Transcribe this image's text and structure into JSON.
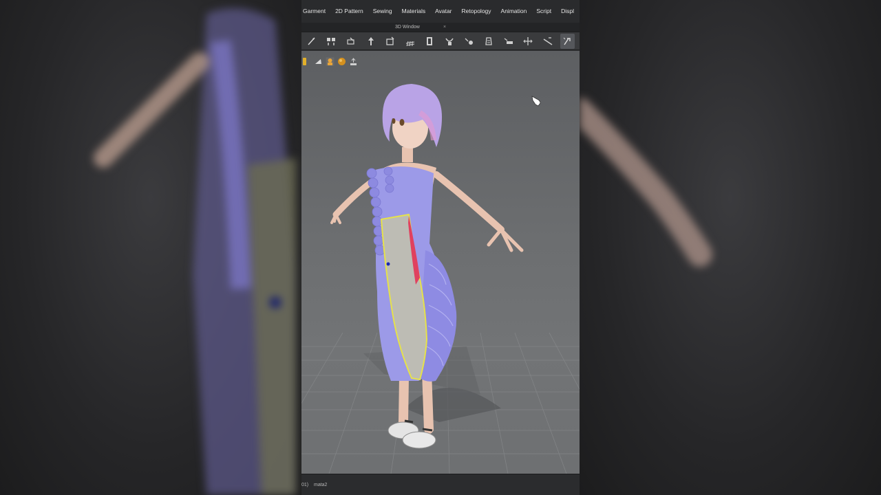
{
  "menu": {
    "items": [
      "Garment",
      "2D Pattern",
      "Sewing",
      "Materials",
      "Avatar",
      "Retopology",
      "Animation",
      "Script",
      "Displ"
    ]
  },
  "window_tab": {
    "title": "3D Window",
    "close": "×"
  },
  "toolbar": {
    "tools": [
      "select-mesh-icon",
      "fold-arrangement-icon",
      "pin-icon",
      "tack-on-avatar-icon",
      "tack-icon",
      "grid-icon",
      "puckering-icon",
      "strap-icon",
      "trim-icon",
      "shrinkwrap-icon",
      "measure-icon",
      "align-icon",
      "bookmark-icon",
      "transform-icon"
    ],
    "active_index": 13
  },
  "view_icons": [
    "garment-view-icon",
    "texture-view-icon",
    "avatar-view-icon",
    "material-ball-icon",
    "camera-reset-icon"
  ],
  "status": {
    "index": "01)",
    "name": "mata2"
  },
  "colors": {
    "dress": "#9c9ae8",
    "hair": "#b9a3e6",
    "selected_outline": "#e6e24a",
    "seam_highlight": "#e0415f",
    "viewport_top": "#5d5f62",
    "viewport_floor": "#7a7c7e"
  }
}
